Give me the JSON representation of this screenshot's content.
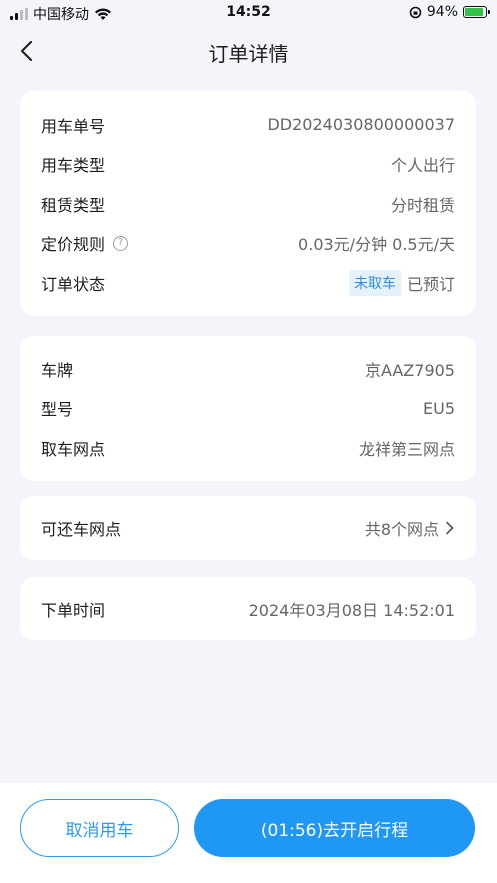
{
  "status_bar": {
    "carrier": "中国移动",
    "time": "14:52",
    "battery_percent": "94%",
    "battery_level": 0.94
  },
  "header": {
    "title": "订单详情"
  },
  "order_info": {
    "rows": [
      {
        "label": "用车单号",
        "value": "DD2024030800000037"
      },
      {
        "label": "用车类型",
        "value": "个人出行"
      },
      {
        "label": "租赁类型",
        "value": "分时租赁"
      },
      {
        "label": "定价规则",
        "value": "0.03元/分钟 0.5元/天"
      },
      {
        "label": "订单状态",
        "badge": "未取车",
        "value": "已预订"
      }
    ]
  },
  "vehicle_info": {
    "rows": [
      {
        "label": "车牌",
        "value": "京AAZ7905"
      },
      {
        "label": "型号",
        "value": "EU5"
      },
      {
        "label": "取车网点",
        "value": "龙祥第三网点"
      }
    ]
  },
  "return_points": {
    "label": "可还车网点",
    "value": "共8个网点"
  },
  "order_time": {
    "label": "下单时间",
    "value": "2024年03月08日 14:52:01"
  },
  "actions": {
    "cancel_label": "取消用车",
    "start_label": "(01:56)去开启行程"
  },
  "colors": {
    "accent": "#1e97f5",
    "badge_bg": "#e5f2fc",
    "badge_text": "#2a8fde",
    "background": "#f3f5fa"
  }
}
